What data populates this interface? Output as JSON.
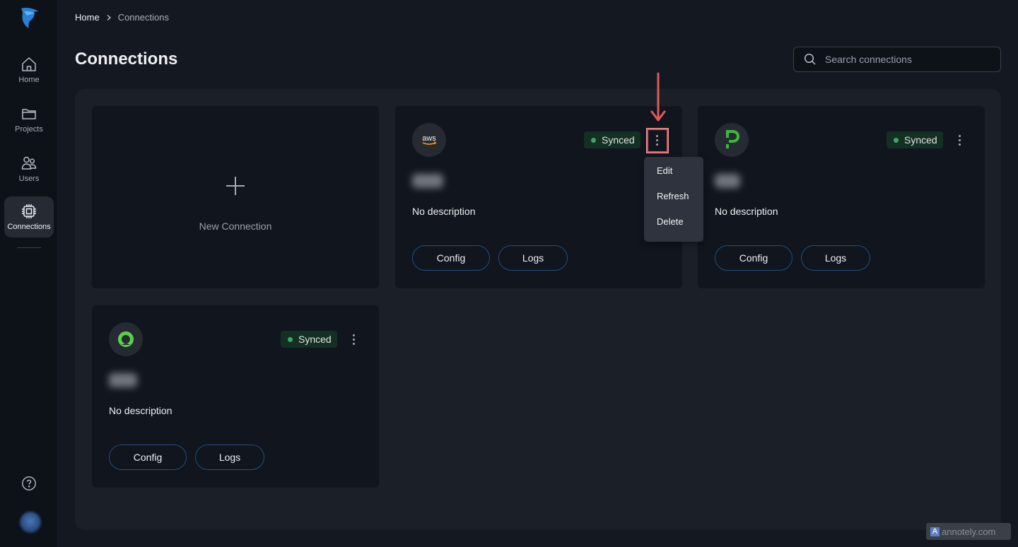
{
  "sidebar": {
    "items": [
      {
        "label": "Home",
        "icon": "home-icon",
        "active": false
      },
      {
        "label": "Projects",
        "icon": "folder-icon",
        "active": false
      },
      {
        "label": "Users",
        "icon": "users-icon",
        "active": false
      },
      {
        "label": "Connections",
        "icon": "chip-icon",
        "active": true
      }
    ],
    "help_icon": "help-circle-icon"
  },
  "breadcrumb": {
    "home": "Home",
    "current": "Connections"
  },
  "page": {
    "title": "Connections"
  },
  "search": {
    "placeholder": "Search connections",
    "value": ""
  },
  "new_connection": {
    "label": "New Connection"
  },
  "connections": [
    {
      "provider": "aws",
      "logo_text": "aws",
      "status": "Synced",
      "description": "No description",
      "config_label": "Config",
      "logs_label": "Logs"
    },
    {
      "provider": "p-logo",
      "logo_text": "P",
      "status": "Synced",
      "description": "No description",
      "config_label": "Config",
      "logs_label": "Logs"
    },
    {
      "provider": "ring-logo",
      "logo_text": "",
      "status": "Synced",
      "description": "No description",
      "config_label": "Config",
      "logs_label": "Logs"
    }
  ],
  "context_menu": {
    "items": [
      "Edit",
      "Refresh",
      "Delete"
    ]
  },
  "colors": {
    "status_synced": "#3fa36f",
    "accent_border": "#1f4f82",
    "annotation": "#e05a5a"
  },
  "watermark": {
    "text": "annotely.com",
    "logo": "A"
  }
}
